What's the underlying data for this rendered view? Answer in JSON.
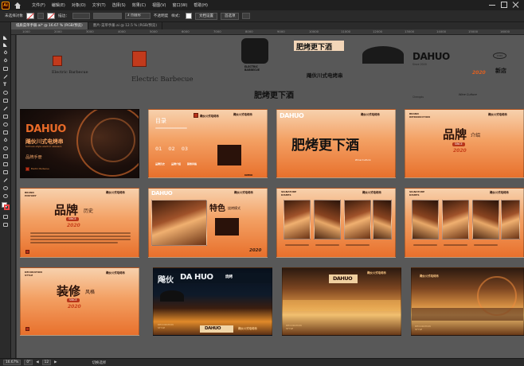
{
  "app": {
    "logo": "Ai"
  },
  "menu": [
    "文件(F)",
    "编辑(E)",
    "对象(O)",
    "文字(T)",
    "选择(S)",
    "效果(C)",
    "视图(V)",
    "窗口(W)",
    "帮助(H)"
  ],
  "control_bar": {
    "selection": "未选择对象",
    "stroke_label": "描边：",
    "stroke_value": "",
    "brush": "3 点圆形",
    "opacity_label": "不透明度",
    "style_label": "样式：",
    "doc_setup": "文档设置",
    "preferences": "首选项"
  },
  "tabs": [
    {
      "label": "纸质菜单手册.ai* @ 16.67 % (RGB/预览)",
      "active": true
    },
    {
      "label": "墨片-菜单手册.ai @ 12.5 % (RGB/预览)",
      "active": false
    }
  ],
  "ruler_ticks": [
    "1000",
    "2000",
    "3000",
    "4000",
    "5000",
    "6000",
    "7000",
    "8000",
    "9000",
    "10000",
    "11000",
    "12000",
    "13000",
    "14000",
    "15000",
    "16000"
  ],
  "assets": {
    "electric_barbecue_1": "Electric Barbecue",
    "electric_barbecue_2": "Electric Barbecue",
    "badge_lines": [
      "ELECTRIC",
      "BARBECUE"
    ],
    "calligraphy_small": "肥烤更下酒",
    "calligraphy_mid": "肥烤更下酒",
    "brand_cn": "飚伙川式电烤串",
    "dahuo_logo": "DAHUO",
    "dahuo_lines": [
      "Since 2020",
      "Chengdu"
    ],
    "dahuo_year": "2020",
    "wine_culture": "Wine Culture",
    "label_tag": "2020",
    "vertical_calligraphy": "新店"
  },
  "boards": {
    "cover": {
      "dahuo": "DAHUO",
      "brand_cn": "飚伙川式电烤串",
      "en": "Sichuan-style electric skewers",
      "handbook": "品牌手册",
      "footer": "Electric Barbecue"
    },
    "toc": {
      "title": "目录",
      "label": "DAHUO",
      "cats": [
        "品牌历史",
        "品牌介绍",
        "装修风格"
      ]
    },
    "slogan": {
      "dahuo": "DAHUO",
      "big": "肥烤更下酒",
      "en": "Wine Culture"
    },
    "intro": {
      "head": "BRAND\nINTRODUCTION",
      "big": "品牌",
      "sub": "介绍",
      "pill": "SINCE",
      "year": "2020"
    },
    "history": {
      "head": "BRAND\nHISTORY",
      "big": "品牌",
      "sub": "历史",
      "pill": "SINCE",
      "year": "2020"
    },
    "feature": {
      "dahuo": "DAHUO",
      "big": "特色",
      "sub": "烧烤模式",
      "year": "2020"
    },
    "signature1": {
      "head": "SIGNATURE\nDISHES"
    },
    "signature2": {
      "head": "SIGNATURE\nDISHES"
    },
    "decoration": {
      "head": "DECORATION\nSTYLE",
      "big": "装修",
      "sub": "风格",
      "pill": "SINCE",
      "year": "2020"
    },
    "storefront": {
      "sign_cn": "飚伙",
      "sign_en": "DA HUO",
      "sign_sub": "烧烤",
      "label": "DECORATION\nSTYLE",
      "door": "DAHUO"
    },
    "interior1": {
      "sign": "DAHUO",
      "label": "DECORATION\nSTYLE"
    },
    "interior2": {
      "label": "DECORATION\nSTYLE"
    }
  },
  "brand_row": "飚伙川式电烤串",
  "status": {
    "zoom": "16.67%",
    "angle": "0°",
    "artboard": "12",
    "mode": "切换选择"
  }
}
